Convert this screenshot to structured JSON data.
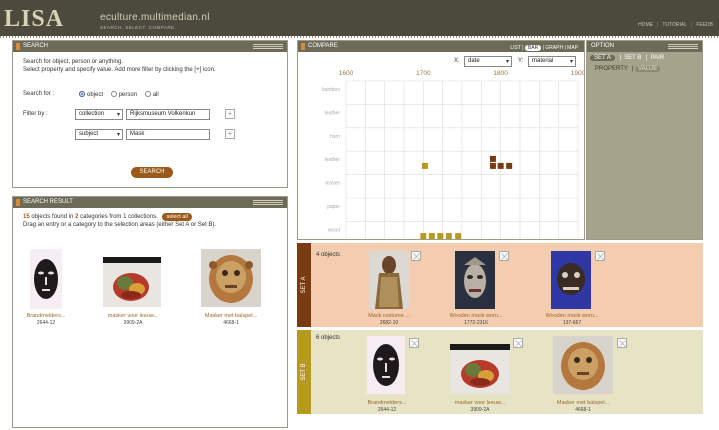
{
  "header": {
    "logo": "LISA",
    "site": "eculture.multimedian.nl",
    "tagline": "SEARCH. SELECT. COMPARE.",
    "nav": [
      "HOME",
      "TUTORIAL",
      "FEEDB"
    ]
  },
  "search": {
    "title": "SEARCH",
    "intro_1": "Search for object, person or anything.",
    "intro_2": "Select property and specify value. Add more filter by clicking the [+] icon.",
    "search_for_label": "Search for :",
    "options": [
      "object",
      "person",
      "all"
    ],
    "selected_option": "object",
    "filter_label": "Filter by :",
    "filter1_property": "collection",
    "filter1_value": "Rijksmuseum Volkenkun",
    "filter2_property": "subject",
    "filter2_value": "Mask",
    "plus": "+",
    "button": "SEARCH"
  },
  "results": {
    "title": "SEARCH RESULT",
    "count_objects": "15",
    "text_1": " objects found in ",
    "count_categories": "2",
    "text_2": " categories from 1 collections.",
    "select_all": "select all",
    "hint": "Drag an entry or a category to the selection areas (either Set A or Set B).",
    "items": [
      {
        "caption": "Brandmelders...",
        "id": "2644-12"
      },
      {
        "caption": "masker voor leeuw...",
        "id": "3909-2A"
      },
      {
        "caption": "Masker met balspel...",
        "id": "4668-1"
      }
    ]
  },
  "compare": {
    "title": "COMPARE",
    "tabs": [
      "LIST",
      "BAR",
      "GRAPH",
      "MAP"
    ],
    "active_tab": "BAR",
    "x_label": "X:",
    "x_value": "date",
    "y_label": "Y:",
    "y_value": "material",
    "x_ticks": [
      "1600",
      "1700",
      "1800",
      "1900"
    ],
    "y_categories": [
      "bamboo",
      "leather",
      "horn",
      "leather",
      "leaves",
      "paper",
      "wood"
    ],
    "colors": {
      "set_a": "#7a3a12",
      "set_b": "#b59a1e"
    },
    "marks": [
      {
        "set": "b",
        "x": 1702,
        "row": 3
      },
      {
        "set": "a",
        "x": 1790,
        "row": 3,
        "stack": 0
      },
      {
        "set": "a",
        "x": 1790,
        "row": 3
      },
      {
        "set": "a",
        "x": 1800,
        "row": 3
      },
      {
        "set": "a",
        "x": 1811,
        "row": 3
      },
      {
        "set": "b",
        "x": 1700,
        "row": 6
      },
      {
        "set": "b",
        "x": 1711,
        "row": 6
      },
      {
        "set": "b",
        "x": 1722,
        "row": 6
      },
      {
        "set": "b",
        "x": 1733,
        "row": 6
      },
      {
        "set": "b",
        "x": 1745,
        "row": 6
      }
    ]
  },
  "option": {
    "title": "OPTION",
    "tabs": [
      "SET A",
      "SET B",
      "PAIR"
    ],
    "active_tab": "SET A",
    "subtabs": [
      "PROPERTY",
      "VALUE"
    ],
    "active_subtab": "VALUE"
  },
  "set_a": {
    "label": "SET A",
    "count": "4 objects",
    "color": "#f4cdb0",
    "items": [
      {
        "caption": "Mask costume ...",
        "id": "2682-10"
      },
      {
        "caption": "Wooden mask worn...",
        "id": "1772-2316"
      },
      {
        "caption": "Wooden mask worn...",
        "id": "137-667"
      }
    ]
  },
  "set_b": {
    "label": "SET B",
    "count": "6 objects",
    "color": "#e7e3c5",
    "items": [
      {
        "caption": "Brandmelders...",
        "id": "2644-12"
      },
      {
        "caption": "masker voor leeuw...",
        "id": "3909-2A"
      },
      {
        "caption": "Masker met balspel...",
        "id": "4668-1"
      }
    ]
  }
}
